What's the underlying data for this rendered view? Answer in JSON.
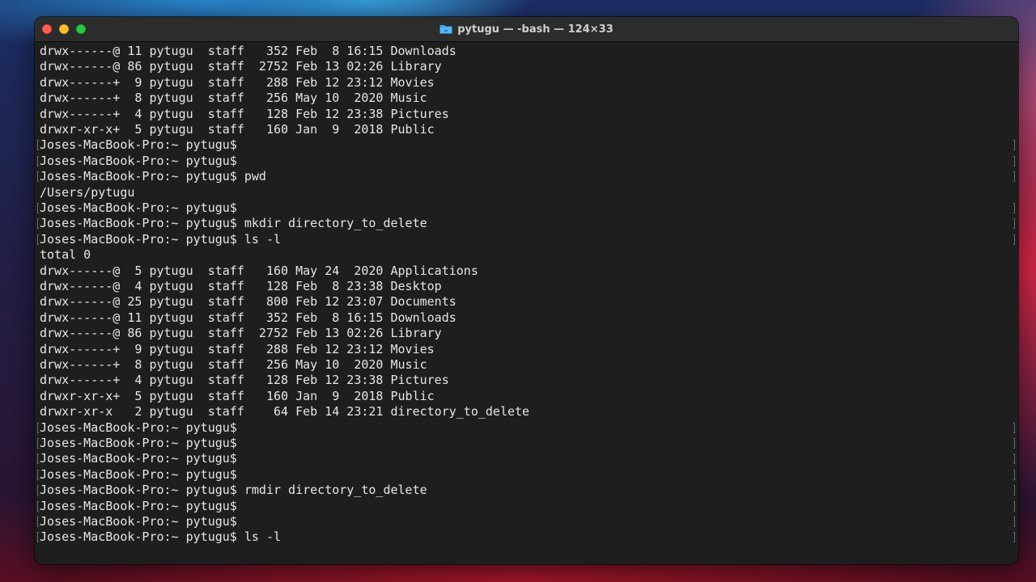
{
  "window": {
    "title": "pytugu — -bash — 124×33",
    "title_icon": "folder-icon",
    "colors": {
      "background": "#1e1e1e",
      "text": "#e6e6e6",
      "titlebar": "#2c2c2c",
      "close": "#ff5f57",
      "minimize": "#febc2e",
      "zoom": "#28c840"
    }
  },
  "terminal": {
    "lines": [
      {
        "text": "drwx------@ 11 pytugu  staff   352 Feb  8 16:15 Downloads",
        "prompt": false
      },
      {
        "text": "drwx------@ 86 pytugu  staff  2752 Feb 13 02:26 Library",
        "prompt": false
      },
      {
        "text": "drwx------+  9 pytugu  staff   288 Feb 12 23:12 Movies",
        "prompt": false
      },
      {
        "text": "drwx------+  8 pytugu  staff   256 May 10  2020 Music",
        "prompt": false
      },
      {
        "text": "drwx------+  4 pytugu  staff   128 Feb 12 23:38 Pictures",
        "prompt": false
      },
      {
        "text": "drwxr-xr-x+  5 pytugu  staff   160 Jan  9  2018 Public",
        "prompt": false
      },
      {
        "text": "Joses-MacBook-Pro:~ pytugu$",
        "prompt": true
      },
      {
        "text": "Joses-MacBook-Pro:~ pytugu$",
        "prompt": true
      },
      {
        "text": "Joses-MacBook-Pro:~ pytugu$ pwd",
        "prompt": true
      },
      {
        "text": "/Users/pytugu",
        "prompt": false
      },
      {
        "text": "Joses-MacBook-Pro:~ pytugu$",
        "prompt": true
      },
      {
        "text": "Joses-MacBook-Pro:~ pytugu$ mkdir directory_to_delete",
        "prompt": true
      },
      {
        "text": "Joses-MacBook-Pro:~ pytugu$ ls -l",
        "prompt": true
      },
      {
        "text": "total 0",
        "prompt": false
      },
      {
        "text": "drwx------@  5 pytugu  staff   160 May 24  2020 Applications",
        "prompt": false
      },
      {
        "text": "drwx------@  4 pytugu  staff   128 Feb  8 23:38 Desktop",
        "prompt": false
      },
      {
        "text": "drwx------@ 25 pytugu  staff   800 Feb 12 23:07 Documents",
        "prompt": false
      },
      {
        "text": "drwx------@ 11 pytugu  staff   352 Feb  8 16:15 Downloads",
        "prompt": false
      },
      {
        "text": "drwx------@ 86 pytugu  staff  2752 Feb 13 02:26 Library",
        "prompt": false
      },
      {
        "text": "drwx------+  9 pytugu  staff   288 Feb 12 23:12 Movies",
        "prompt": false
      },
      {
        "text": "drwx------+  8 pytugu  staff   256 May 10  2020 Music",
        "prompt": false
      },
      {
        "text": "drwx------+  4 pytugu  staff   128 Feb 12 23:38 Pictures",
        "prompt": false
      },
      {
        "text": "drwxr-xr-x+  5 pytugu  staff   160 Jan  9  2018 Public",
        "prompt": false
      },
      {
        "text": "drwxr-xr-x   2 pytugu  staff    64 Feb 14 23:21 directory_to_delete",
        "prompt": false
      },
      {
        "text": "Joses-MacBook-Pro:~ pytugu$",
        "prompt": true
      },
      {
        "text": "Joses-MacBook-Pro:~ pytugu$",
        "prompt": true
      },
      {
        "text": "Joses-MacBook-Pro:~ pytugu$",
        "prompt": true
      },
      {
        "text": "Joses-MacBook-Pro:~ pytugu$",
        "prompt": true
      },
      {
        "text": "Joses-MacBook-Pro:~ pytugu$ rmdir directory_to_delete",
        "prompt": true
      },
      {
        "text": "Joses-MacBook-Pro:~ pytugu$",
        "prompt": true
      },
      {
        "text": "Joses-MacBook-Pro:~ pytugu$",
        "prompt": true
      },
      {
        "text": "Joses-MacBook-Pro:~ pytugu$ ls -l",
        "prompt": true
      }
    ]
  }
}
